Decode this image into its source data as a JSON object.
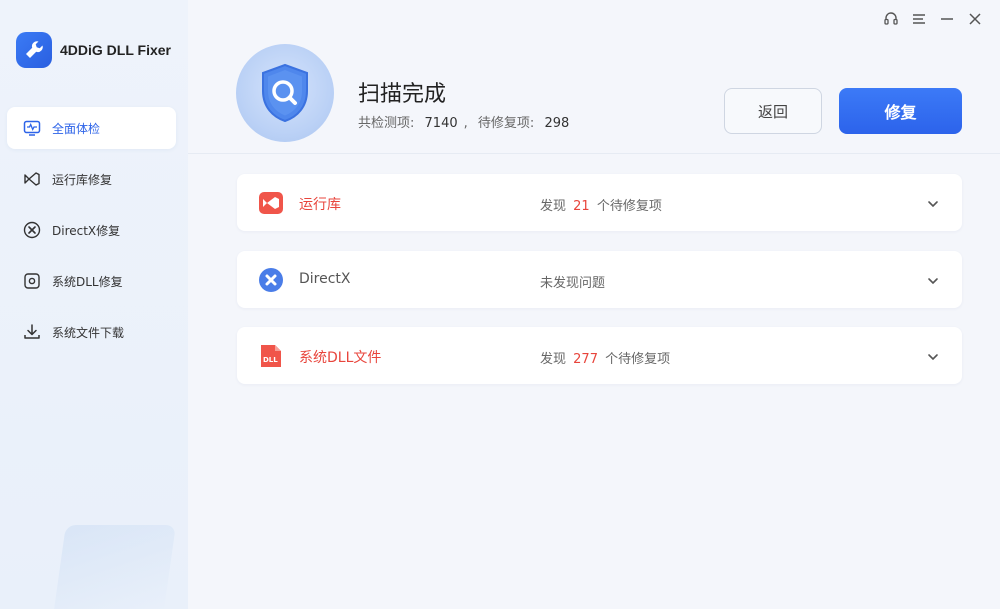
{
  "app": {
    "name": "4DDiG DLL Fixer"
  },
  "sidebar": {
    "items": [
      {
        "label": "全面体检",
        "icon": "monitor-pulse-icon",
        "active": true
      },
      {
        "label": "运行库修复",
        "icon": "visual-studio-icon",
        "active": false
      },
      {
        "label": "DirectX修复",
        "icon": "directx-icon",
        "active": false
      },
      {
        "label": "系统DLL修复",
        "icon": "dll-file-icon",
        "active": false
      },
      {
        "label": "系统文件下载",
        "icon": "download-icon",
        "active": false
      }
    ]
  },
  "window_controls": [
    "headset-icon",
    "menu-icon",
    "minimize-icon",
    "close-icon"
  ],
  "header": {
    "title": "扫描完成",
    "total_label": "共检测项:",
    "total_value": "7140",
    "separator": ",",
    "pending_label": "待修复项:",
    "pending_value": "298",
    "back_label": "返回",
    "fix_label": "修复"
  },
  "results": [
    {
      "name": "运行库",
      "status_prefix": "发现",
      "count": "21",
      "status_suffix": "个待修复项",
      "icon": "visual-studio-icon",
      "state": "issue"
    },
    {
      "name": "DirectX",
      "status_prefix": "未发现问题",
      "count": "",
      "status_suffix": "",
      "icon": "directx-icon",
      "state": "ok"
    },
    {
      "name": "系统DLL文件",
      "status_prefix": "发现",
      "count": "277",
      "status_suffix": "个待修复项",
      "icon": "dll-file-icon",
      "state": "issue"
    }
  ],
  "colors": {
    "accent": "#2d63e8",
    "danger": "#e8453c",
    "sidebar_bg": "#eef3fb"
  }
}
